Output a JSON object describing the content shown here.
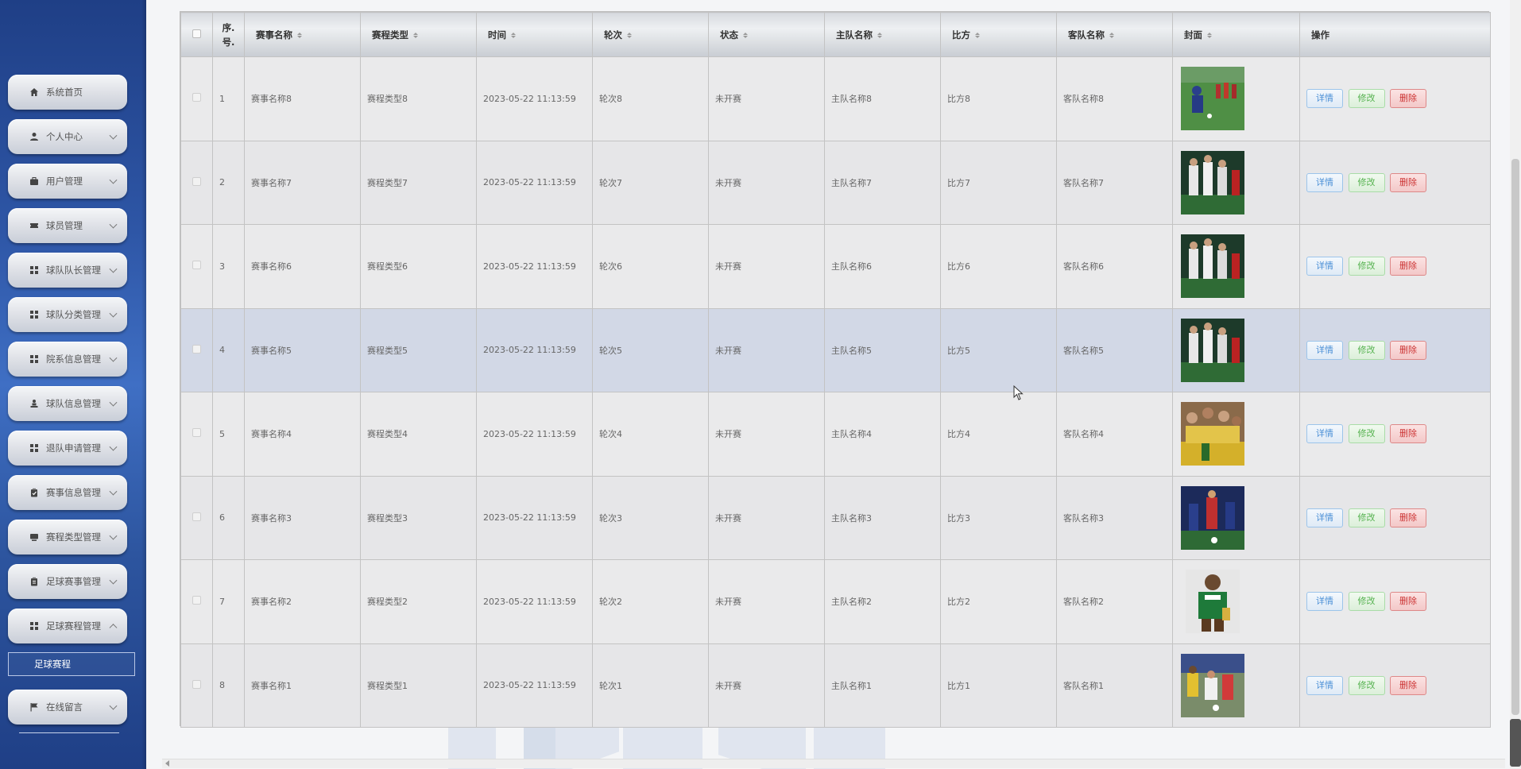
{
  "sidebar": {
    "items": [
      {
        "label": "系统首页",
        "icon": "home-icon",
        "chevron": "none"
      },
      {
        "label": "个人中心",
        "icon": "user-icon",
        "chevron": "down"
      },
      {
        "label": "用户管理",
        "icon": "briefcase-icon",
        "chevron": "down"
      },
      {
        "label": "球员管理",
        "icon": "ticket-icon",
        "chevron": "down"
      },
      {
        "label": "球队队长管理",
        "icon": "grid-icon",
        "chevron": "down"
      },
      {
        "label": "球队分类管理",
        "icon": "grid-icon",
        "chevron": "down"
      },
      {
        "label": "院系信息管理",
        "icon": "grid-icon",
        "chevron": "down"
      },
      {
        "label": "球队信息管理",
        "icon": "person-icon",
        "chevron": "down"
      },
      {
        "label": "退队申请管理",
        "icon": "grid-icon",
        "chevron": "down"
      },
      {
        "label": "赛事信息管理",
        "icon": "clipboard-icon",
        "chevron": "down"
      },
      {
        "label": "赛程类型管理",
        "icon": "monitor-icon",
        "chevron": "down"
      },
      {
        "label": "足球赛事管理",
        "icon": "clipboard-icon",
        "chevron": "down"
      },
      {
        "label": "足球赛程管理",
        "icon": "grid-icon",
        "chevron": "up"
      },
      {
        "label": "在线留言",
        "icon": "flag-icon",
        "chevron": "down"
      }
    ],
    "submenu_label": "足球赛程"
  },
  "table": {
    "columns": [
      "序号",
      "赛事名称",
      "赛程类型",
      "时间",
      "轮次",
      "状态",
      "主队名称",
      "比方",
      "客队名称",
      "封面",
      "操作"
    ],
    "index_header": {
      "line1": "序.",
      "line2": "号."
    },
    "rows": [
      {
        "no": "1",
        "name": "赛事名称8",
        "type": "赛程类型8",
        "time": "2023-05-22 11:13:59",
        "round": "轮次8",
        "status": "未开赛",
        "home": "主队名称8",
        "score": "比方8",
        "away": "客队名称8"
      },
      {
        "no": "2",
        "name": "赛事名称7",
        "type": "赛程类型7",
        "time": "2023-05-22 11:13:59",
        "round": "轮次7",
        "status": "未开赛",
        "home": "主队名称7",
        "score": "比方7",
        "away": "客队名称7"
      },
      {
        "no": "3",
        "name": "赛事名称6",
        "type": "赛程类型6",
        "time": "2023-05-22 11:13:59",
        "round": "轮次6",
        "status": "未开赛",
        "home": "主队名称6",
        "score": "比方6",
        "away": "客队名称6"
      },
      {
        "no": "4",
        "name": "赛事名称5",
        "type": "赛程类型5",
        "time": "2023-05-22 11:13:59",
        "round": "轮次5",
        "status": "未开赛",
        "home": "主队名称5",
        "score": "比方5",
        "away": "客队名称5"
      },
      {
        "no": "5",
        "name": "赛事名称4",
        "type": "赛程类型4",
        "time": "2023-05-22 11:13:59",
        "round": "轮次4",
        "status": "未开赛",
        "home": "主队名称4",
        "score": "比方4",
        "away": "客队名称4"
      },
      {
        "no": "6",
        "name": "赛事名称3",
        "type": "赛程类型3",
        "time": "2023-05-22 11:13:59",
        "round": "轮次3",
        "status": "未开赛",
        "home": "主队名称3",
        "score": "比方3",
        "away": "客队名称3"
      },
      {
        "no": "7",
        "name": "赛事名称2",
        "type": "赛程类型2",
        "time": "2023-05-22 11:13:59",
        "round": "轮次2",
        "status": "未开赛",
        "home": "主队名称2",
        "score": "比方2",
        "away": "客队名称2"
      },
      {
        "no": "8",
        "name": "赛事名称1",
        "type": "赛程类型1",
        "time": "2023-05-22 11:13:59",
        "round": "轮次1",
        "status": "未开赛",
        "home": "主队名称1",
        "score": "比方1",
        "away": "客队名称1"
      }
    ],
    "actions": {
      "detail": "详情",
      "edit": "修改",
      "delete": "删除"
    }
  },
  "colors": {
    "sidebar_top": "#1f3f86",
    "sidebar_mid": "#3f6fc4",
    "row_hover": "#d2d8e6",
    "detail": "#4a8fd6",
    "edit": "#55b24f",
    "delete": "#cc3333"
  }
}
